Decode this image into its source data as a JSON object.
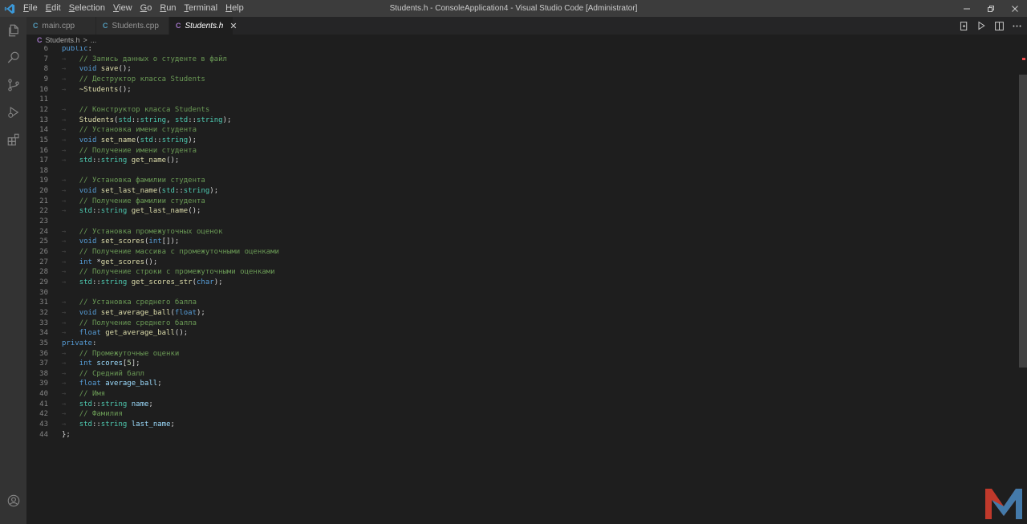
{
  "window": {
    "title": "Students.h - ConsoleApplication4 - Visual Studio Code [Administrator]"
  },
  "menu": [
    {
      "label": "File",
      "mnemonic": "F",
      "rest": "ile"
    },
    {
      "label": "Edit",
      "mnemonic": "E",
      "rest": "dit"
    },
    {
      "label": "Selection",
      "mnemonic": "S",
      "rest": "election"
    },
    {
      "label": "View",
      "mnemonic": "V",
      "rest": "iew"
    },
    {
      "label": "Go",
      "mnemonic": "G",
      "rest": "o"
    },
    {
      "label": "Run",
      "mnemonic": "R",
      "rest": "un"
    },
    {
      "label": "Terminal",
      "mnemonic": "T",
      "rest": "erminal"
    },
    {
      "label": "Help",
      "mnemonic": "H",
      "rest": "elp"
    }
  ],
  "tabs": [
    {
      "label": "main.cpp",
      "icon": "C",
      "icon_color": "#519aba",
      "active": false
    },
    {
      "label": "Students.cpp",
      "icon": "C",
      "icon_color": "#519aba",
      "active": false
    },
    {
      "label": "Students.h",
      "icon": "C",
      "icon_color": "#a074c4",
      "active": true
    }
  ],
  "breadcrumb": {
    "icon": "C",
    "file": "Students.h",
    "sep": ">",
    "more": "..."
  },
  "colors": {
    "titlebar": "#3c3c3c",
    "activitybar": "#333333",
    "editor_bg": "#1e1e1e",
    "comment": "#6a9955",
    "keyword": "#569cd6",
    "function": "#dcdcaa",
    "type": "#4ec9b0"
  },
  "code": [
    {
      "n": "6",
      "tokens": [
        [
          "kw",
          "public"
        ],
        [
          "pun",
          ":"
        ]
      ]
    },
    {
      "n": "7",
      "tokens": [
        [
          "ws",
          "→   "
        ],
        [
          "comment",
          "// Запись данных о студенте в файл"
        ]
      ]
    },
    {
      "n": "8",
      "tokens": [
        [
          "ws",
          "→   "
        ],
        [
          "kw",
          "void"
        ],
        [
          "pun",
          " "
        ],
        [
          "fn",
          "save"
        ],
        [
          "pun",
          "();"
        ]
      ]
    },
    {
      "n": "9",
      "tokens": [
        [
          "ws",
          "→   "
        ],
        [
          "comment",
          "// Деструктор класса Students"
        ]
      ]
    },
    {
      "n": "10",
      "tokens": [
        [
          "ws",
          "→   "
        ],
        [
          "fn",
          "~Students"
        ],
        [
          "pun",
          "();"
        ]
      ]
    },
    {
      "n": "11",
      "tokens": []
    },
    {
      "n": "12",
      "tokens": [
        [
          "ws",
          "→   "
        ],
        [
          "comment",
          "// Конструктор класса Students"
        ]
      ]
    },
    {
      "n": "13",
      "tokens": [
        [
          "ws",
          "→   "
        ],
        [
          "fn",
          "Students"
        ],
        [
          "pun",
          "("
        ],
        [
          "type",
          "std"
        ],
        [
          "pun",
          "::"
        ],
        [
          "type",
          "string"
        ],
        [
          "pun",
          ", "
        ],
        [
          "type",
          "std"
        ],
        [
          "pun",
          "::"
        ],
        [
          "type",
          "string"
        ],
        [
          "pun",
          ");"
        ]
      ]
    },
    {
      "n": "14",
      "tokens": [
        [
          "ws",
          "→   "
        ],
        [
          "comment",
          "// Установка имени студента"
        ]
      ]
    },
    {
      "n": "15",
      "tokens": [
        [
          "ws",
          "→   "
        ],
        [
          "kw",
          "void"
        ],
        [
          "pun",
          " "
        ],
        [
          "fn",
          "set_name"
        ],
        [
          "pun",
          "("
        ],
        [
          "type",
          "std"
        ],
        [
          "pun",
          "::"
        ],
        [
          "type",
          "string"
        ],
        [
          "pun",
          ");"
        ]
      ]
    },
    {
      "n": "16",
      "tokens": [
        [
          "ws",
          "→   "
        ],
        [
          "comment",
          "// Получение имени студента"
        ]
      ]
    },
    {
      "n": "17",
      "tokens": [
        [
          "ws",
          "→   "
        ],
        [
          "type",
          "std"
        ],
        [
          "pun",
          "::"
        ],
        [
          "type",
          "string"
        ],
        [
          "pun",
          " "
        ],
        [
          "fn",
          "get_name"
        ],
        [
          "pun",
          "();"
        ]
      ]
    },
    {
      "n": "18",
      "tokens": []
    },
    {
      "n": "19",
      "tokens": [
        [
          "ws",
          "→   "
        ],
        [
          "comment",
          "// Установка фамилии студента"
        ]
      ]
    },
    {
      "n": "20",
      "tokens": [
        [
          "ws",
          "→   "
        ],
        [
          "kw",
          "void"
        ],
        [
          "pun",
          " "
        ],
        [
          "fn",
          "set_last_name"
        ],
        [
          "pun",
          "("
        ],
        [
          "type",
          "std"
        ],
        [
          "pun",
          "::"
        ],
        [
          "type",
          "string"
        ],
        [
          "pun",
          ");"
        ]
      ]
    },
    {
      "n": "21",
      "tokens": [
        [
          "ws",
          "→   "
        ],
        [
          "comment",
          "// Получение фамилии студента"
        ]
      ]
    },
    {
      "n": "22",
      "tokens": [
        [
          "ws",
          "→   "
        ],
        [
          "type",
          "std"
        ],
        [
          "pun",
          "::"
        ],
        [
          "type",
          "string"
        ],
        [
          "pun",
          " "
        ],
        [
          "fn",
          "get_last_name"
        ],
        [
          "pun",
          "();"
        ]
      ]
    },
    {
      "n": "23",
      "tokens": []
    },
    {
      "n": "24",
      "tokens": [
        [
          "ws",
          "→   "
        ],
        [
          "comment",
          "// Установка промежуточных оценок"
        ]
      ]
    },
    {
      "n": "25",
      "tokens": [
        [
          "ws",
          "→   "
        ],
        [
          "kw",
          "void"
        ],
        [
          "pun",
          " "
        ],
        [
          "fn",
          "set_scores"
        ],
        [
          "pun",
          "("
        ],
        [
          "kw",
          "int"
        ],
        [
          "pun",
          "[]);"
        ]
      ]
    },
    {
      "n": "26",
      "tokens": [
        [
          "ws",
          "→   "
        ],
        [
          "comment",
          "// Получение массива с промежуточными оценками"
        ]
      ]
    },
    {
      "n": "27",
      "tokens": [
        [
          "ws",
          "→   "
        ],
        [
          "kw",
          "int"
        ],
        [
          "pun",
          " *"
        ],
        [
          "fn",
          "get_scores"
        ],
        [
          "pun",
          "();"
        ]
      ]
    },
    {
      "n": "28",
      "tokens": [
        [
          "ws",
          "→   "
        ],
        [
          "comment",
          "// Получение строки с промежуточными оценками"
        ]
      ]
    },
    {
      "n": "29",
      "tokens": [
        [
          "ws",
          "→   "
        ],
        [
          "type",
          "std"
        ],
        [
          "pun",
          "::"
        ],
        [
          "type",
          "string"
        ],
        [
          "pun",
          " "
        ],
        [
          "fn",
          "get_scores_str"
        ],
        [
          "pun",
          "("
        ],
        [
          "kw",
          "char"
        ],
        [
          "pun",
          ");"
        ]
      ]
    },
    {
      "n": "30",
      "tokens": []
    },
    {
      "n": "31",
      "tokens": [
        [
          "ws",
          "→   "
        ],
        [
          "comment",
          "// Установка среднего балла"
        ]
      ]
    },
    {
      "n": "32",
      "tokens": [
        [
          "ws",
          "→   "
        ],
        [
          "kw",
          "void"
        ],
        [
          "pun",
          " "
        ],
        [
          "fn",
          "set_average_ball"
        ],
        [
          "pun",
          "("
        ],
        [
          "kw",
          "float"
        ],
        [
          "pun",
          ");"
        ]
      ]
    },
    {
      "n": "33",
      "tokens": [
        [
          "ws",
          "→   "
        ],
        [
          "comment",
          "// Получение среднего балла"
        ]
      ]
    },
    {
      "n": "34",
      "tokens": [
        [
          "ws",
          "→   "
        ],
        [
          "kw",
          "float"
        ],
        [
          "pun",
          " "
        ],
        [
          "fn",
          "get_average_ball"
        ],
        [
          "pun",
          "();"
        ]
      ]
    },
    {
      "n": "35",
      "tokens": [
        [
          "kw",
          "private"
        ],
        [
          "pun",
          ":"
        ]
      ]
    },
    {
      "n": "36",
      "tokens": [
        [
          "ws",
          "→   "
        ],
        [
          "comment",
          "// Промежуточные оценки"
        ]
      ]
    },
    {
      "n": "37",
      "tokens": [
        [
          "ws",
          "→   "
        ],
        [
          "kw",
          "int"
        ],
        [
          "pun",
          " "
        ],
        [
          "var",
          "scores"
        ],
        [
          "pun",
          "["
        ],
        [
          "num",
          "5"
        ],
        [
          "pun",
          "];"
        ]
      ]
    },
    {
      "n": "38",
      "tokens": [
        [
          "ws",
          "→   "
        ],
        [
          "comment",
          "// Средний балл"
        ]
      ]
    },
    {
      "n": "39",
      "tokens": [
        [
          "ws",
          "→   "
        ],
        [
          "kw",
          "float"
        ],
        [
          "pun",
          " "
        ],
        [
          "var",
          "average_ball"
        ],
        [
          "pun",
          ";"
        ]
      ]
    },
    {
      "n": "40",
      "tokens": [
        [
          "ws",
          "→   "
        ],
        [
          "comment",
          "// Имя"
        ]
      ]
    },
    {
      "n": "41",
      "tokens": [
        [
          "ws",
          "→   "
        ],
        [
          "type",
          "std"
        ],
        [
          "pun",
          "::"
        ],
        [
          "type",
          "string"
        ],
        [
          "pun",
          " "
        ],
        [
          "var",
          "name"
        ],
        [
          "pun",
          ";"
        ]
      ]
    },
    {
      "n": "42",
      "tokens": [
        [
          "ws",
          "→   "
        ],
        [
          "comment",
          "// Фамилия"
        ]
      ]
    },
    {
      "n": "43",
      "tokens": [
        [
          "ws",
          "→   "
        ],
        [
          "type",
          "std"
        ],
        [
          "pun",
          "::"
        ],
        [
          "type",
          "string"
        ],
        [
          "pun",
          " "
        ],
        [
          "var",
          "last_name"
        ],
        [
          "pun",
          ";"
        ]
      ]
    },
    {
      "n": "44",
      "tokens": [
        [
          "pun",
          "};"
        ]
      ]
    }
  ],
  "activity_icons": [
    "explorer-icon",
    "search-icon",
    "source-control-icon",
    "run-debug-icon",
    "extensions-icon",
    "account-icon"
  ]
}
